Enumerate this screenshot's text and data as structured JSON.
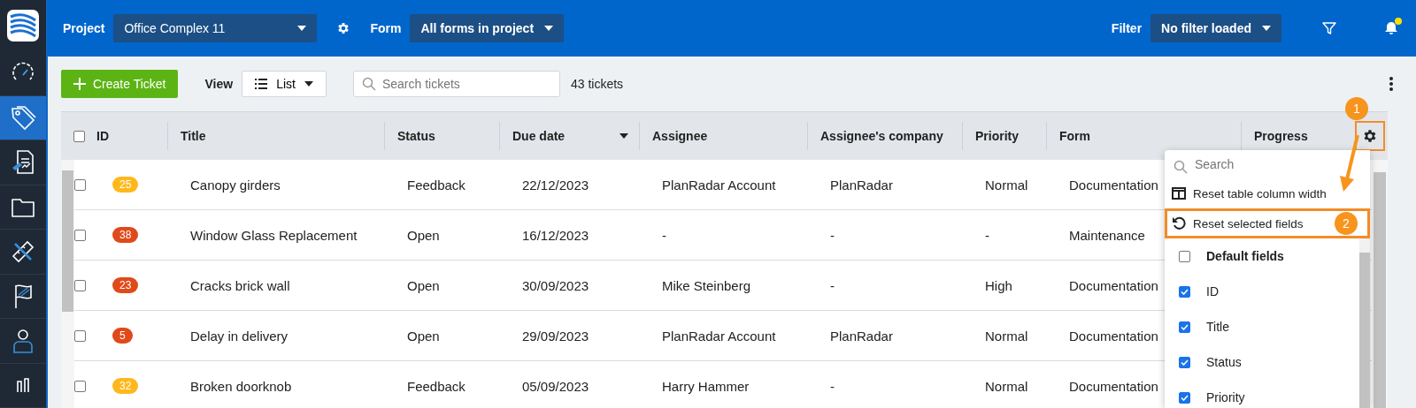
{
  "sidebar": {
    "items": [
      {
        "kind": "gauge",
        "selected": false
      },
      {
        "kind": "tag",
        "selected": true
      },
      {
        "kind": "report",
        "selected": false
      },
      {
        "kind": "folder",
        "selected": false
      },
      {
        "kind": "ruler",
        "selected": false
      },
      {
        "kind": "flag",
        "selected": false
      },
      {
        "kind": "person",
        "selected": false
      },
      {
        "kind": "chart",
        "selected": false
      }
    ]
  },
  "top_bar": {
    "project_label": "Project",
    "project_value": "Office Complex 11",
    "form_label": "Form",
    "form_value": "All forms in project",
    "filter_label": "Filter",
    "filter_value": "No filter loaded",
    "notification": true
  },
  "toolbar": {
    "create_button": "Create Ticket",
    "view_label": "View",
    "view_value": "List",
    "search": {
      "placeholder": "Search tickets"
    },
    "count": "43 tickets"
  },
  "table": {
    "select_all_checked": false,
    "columns": [
      {
        "label": "ID",
        "sorted": false
      },
      {
        "label": "Title",
        "sorted": false
      },
      {
        "label": "Status",
        "sorted": false
      },
      {
        "label": "Due date",
        "sorted": true
      },
      {
        "label": "Assignee",
        "sorted": false
      },
      {
        "label": "Assignee's company",
        "sorted": false
      },
      {
        "label": "Priority",
        "sorted": false
      },
      {
        "label": "Form",
        "sorted": false
      },
      {
        "label": "Progress",
        "sorted": false
      }
    ],
    "rows": [
      {
        "checked": false,
        "id": "25",
        "color": "#ffb81c",
        "title": "Canopy girders",
        "status": "Feedback",
        "due_date": "22/12/2023",
        "assignee": "PlanRadar Account",
        "company": "PlanRadar",
        "priority": "Normal",
        "form": "Documentation"
      },
      {
        "checked": false,
        "id": "38",
        "color": "#e04a1a",
        "title": "Window Glass Replacement",
        "status": "Open",
        "due_date": "16/12/2023",
        "assignee": "-",
        "company": "-",
        "priority": "-",
        "form": "Maintenance"
      },
      {
        "checked": false,
        "id": "23",
        "color": "#e04a1a",
        "title": "Cracks brick wall",
        "status": "Open",
        "due_date": "30/09/2023",
        "assignee": "Mike Steinberg",
        "company": "-",
        "priority": "High",
        "form": "Documentation"
      },
      {
        "checked": false,
        "id": "5",
        "color": "#e04a1a",
        "title": "Delay in delivery",
        "status": "Open",
        "due_date": "29/09/2023",
        "assignee": "PlanRadar Account",
        "company": "PlanRadar",
        "priority": "Normal",
        "form": "Documentation"
      },
      {
        "checked": false,
        "id": "32",
        "color": "#ffb81c",
        "title": "Broken doorknob",
        "status": "Feedback",
        "due_date": "05/09/2023",
        "assignee": "Harry Hammer",
        "company": "-",
        "priority": "Normal",
        "form": "Documentation"
      }
    ]
  },
  "column_menu": {
    "search": {
      "placeholder": "Search"
    },
    "actions": [
      {
        "kind": "columns",
        "label": "Reset table column width",
        "highlighted": false
      },
      {
        "kind": "reset",
        "label": "Reset selected fields",
        "highlighted": true
      }
    ],
    "fields": [
      {
        "label": "Default fields",
        "checked": false,
        "kind": "group"
      },
      {
        "label": "ID",
        "checked": true,
        "kind": "field"
      },
      {
        "label": "Title",
        "checked": true,
        "kind": "field"
      },
      {
        "label": "Status",
        "checked": true,
        "kind": "field"
      },
      {
        "label": "Priority",
        "checked": true,
        "kind": "field"
      }
    ]
  },
  "callouts": [
    "1",
    "2"
  ]
}
